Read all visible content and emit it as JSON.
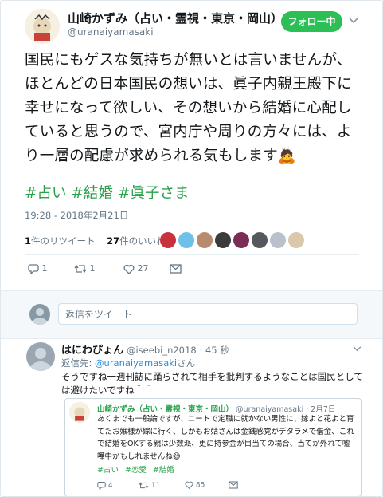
{
  "tweet": {
    "author_name": "山崎かずみ（占い・霊視・東京・岡山）",
    "author_handle": "@uranaiyamasaki",
    "follow_label": "フォロー中",
    "text": "国民にもゲスな気持ちが無いとは言いませんが、ほとんどの日本国民の想いは、眞子内親王殿下に幸せになって欲しい、その想いから結婚に心配していると思うので、宮内庁や周りの方々には、より一層の配慮が求められる気もします🙇",
    "hashtags": [
      "#占い",
      "#結婚",
      "#眞子さま"
    ],
    "timestamp": "19:28 - 2018年2月21日",
    "retweets_count": "1",
    "retweets_label": "件のリツイート",
    "likes_count": "27",
    "likes_label": "件のいいね",
    "reply_count": "1",
    "retweet_count": "1",
    "like_count": "27"
  },
  "reply_box": {
    "placeholder": "返信をツイート"
  },
  "reply": {
    "author_name": "はにわぴょん",
    "author_handle": "@iseebi_n2018",
    "time": "· 45 秒",
    "reply_to_label": "返信先: ",
    "reply_to_handle": "@uranaiyamasaki",
    "reply_to_suffix": "さん",
    "text": "そうですね一週刊誌に踊らされて相手を批判するようなことは国民としては避けたいですね＾＾"
  },
  "quote": {
    "author_name": "山崎かずみ（占い・霊視・東京・岡山）",
    "author_handle": "@uranaiyamasaki",
    "date": "· 2月7日",
    "text": "あくまでも一般論ですが、ニートで定職に就かない男性に、嫁よと花よと育てたお嬢様が嫁に行く、しかもお姑さんは金銭感覚がデタラメで借金、これで結婚をOKする親は少数派、更に持参金が目当ての場合、当てが外れて嘘嘩中かもしれませんね😅",
    "hashtags": [
      "#占い",
      "#恋愛",
      "#結婚"
    ],
    "reply_count": "4",
    "retweet_count": "11",
    "like_count": "85"
  },
  "colors": {
    "accent_green": "#2aa14b",
    "follow_green": "#2bbf55",
    "link_blue": "#2a8ad8",
    "muted": "#657786"
  },
  "icons": [
    "reply-icon",
    "retweet-icon",
    "heart-icon",
    "mail-icon",
    "chevron-down-icon"
  ]
}
